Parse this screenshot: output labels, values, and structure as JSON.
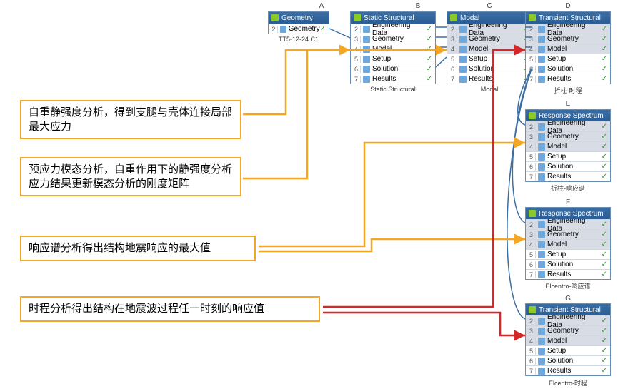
{
  "columns": {
    "A": "A",
    "B": "B",
    "C": "C",
    "D": "D",
    "E": "E",
    "F": "F",
    "G": "G"
  },
  "blocks": {
    "A": {
      "title": "Geometry",
      "rows": [
        [
          "2",
          "Geometry"
        ]
      ],
      "caption": "TT5-12-24 C1"
    },
    "B": {
      "title": "Static Structural",
      "rows": [
        [
          "2",
          "Engineering Data"
        ],
        [
          "3",
          "Geometry"
        ],
        [
          "4",
          "Model"
        ],
        [
          "5",
          "Setup"
        ],
        [
          "6",
          "Solution"
        ],
        [
          "7",
          "Results"
        ]
      ],
      "caption": "Static Structural"
    },
    "C": {
      "title": "Modal",
      "rows": [
        [
          "2",
          "Engineering Data"
        ],
        [
          "3",
          "Geometry"
        ],
        [
          "4",
          "Model"
        ],
        [
          "5",
          "Setup"
        ],
        [
          "6",
          "Solution"
        ],
        [
          "7",
          "Results"
        ]
      ],
      "caption": "Modal",
      "highlight": [
        0,
        1,
        2
      ]
    },
    "D": {
      "title": "Transient Structural",
      "rows": [
        [
          "2",
          "Engineering Data"
        ],
        [
          "3",
          "Geometry"
        ],
        [
          "4",
          "Model"
        ],
        [
          "5",
          "Setup"
        ],
        [
          "6",
          "Solution"
        ],
        [
          "7",
          "Results"
        ]
      ],
      "caption": "折柱-时程",
      "highlight": [
        0,
        1,
        2
      ]
    },
    "E": {
      "title": "Response Spectrum",
      "rows": [
        [
          "2",
          "Engineering Data"
        ],
        [
          "3",
          "Geometry"
        ],
        [
          "4",
          "Model"
        ],
        [
          "5",
          "Setup"
        ],
        [
          "6",
          "Solution"
        ],
        [
          "7",
          "Results"
        ]
      ],
      "caption": "折柱-响应谱",
      "highlight": [
        0,
        1,
        2
      ]
    },
    "F": {
      "title": "Response Spectrum",
      "rows": [
        [
          "2",
          "Engineering Data"
        ],
        [
          "3",
          "Geometry"
        ],
        [
          "4",
          "Model"
        ],
        [
          "5",
          "Setup"
        ],
        [
          "6",
          "Solution"
        ],
        [
          "7",
          "Results"
        ]
      ],
      "caption": "Elcentro-响应谱",
      "highlight": [
        0,
        1,
        2
      ]
    },
    "G": {
      "title": "Transient Structural",
      "rows": [
        [
          "2",
          "Engineering Data"
        ],
        [
          "3",
          "Geometry"
        ],
        [
          "4",
          "Model"
        ],
        [
          "5",
          "Setup"
        ],
        [
          "6",
          "Solution"
        ],
        [
          "7",
          "Results"
        ]
      ],
      "caption": "Elcentro-时程",
      "highlight": [
        0,
        1,
        2
      ]
    }
  },
  "annotations": {
    "a1": "自重静强度分析，得到支腿与壳体连接局部最大应力",
    "a2": "预应力模态分析，自重作用下的静强度分析应力结果更新模态分析的刚度矩阵",
    "a3": "响应谱分析得出结构地震响应的最大值",
    "a4": "时程分析得出结构在地震波过程任一时刻的响应值"
  },
  "colors": {
    "annot_border": "#f5a623",
    "arrow_red": "#d62728",
    "arrow_orange": "#f5a623",
    "link_blue": "#3a6ea5"
  }
}
